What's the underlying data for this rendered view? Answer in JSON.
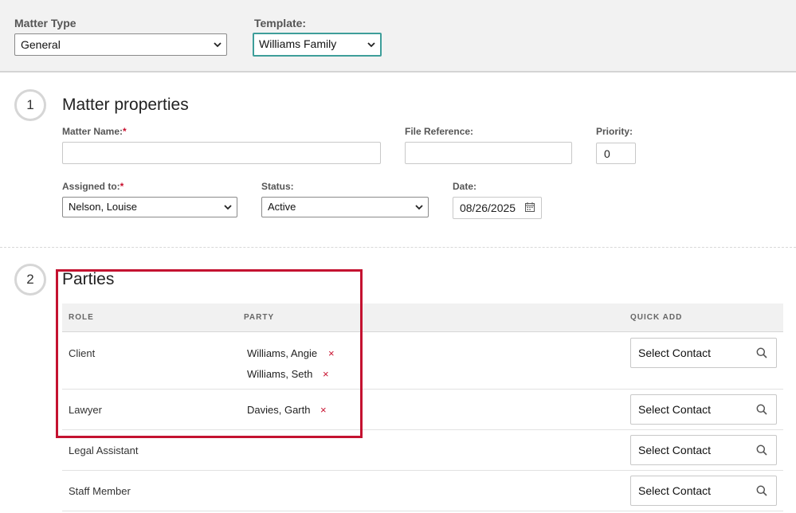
{
  "header": {
    "matter_type_label": "Matter Type",
    "matter_type_value": "General",
    "template_label": "Template:",
    "template_value": "Williams Family"
  },
  "matter_properties": {
    "step": "1",
    "title": "Matter properties",
    "matter_name_label": "Matter Name:",
    "matter_name_value": "",
    "file_reference_label": "File Reference:",
    "file_reference_value": "",
    "priority_label": "Priority:",
    "priority_value": "0",
    "assigned_to_label": "Assigned to:",
    "assigned_to_value": "Nelson, Louise",
    "status_label": "Status:",
    "status_value": "Active",
    "date_label": "Date:",
    "date_value": "08/26/2025",
    "required_marker": "*"
  },
  "parties": {
    "step": "2",
    "title": "Parties",
    "columns": {
      "role": "ROLE",
      "party": "PARTY",
      "quick_add": "QUICK ADD"
    },
    "rows": [
      {
        "role": "Client",
        "parties": [
          "Williams, Angie",
          "Williams, Seth"
        ],
        "quick_add": "Select Contact"
      },
      {
        "role": "Lawyer",
        "parties": [
          "Davies, Garth"
        ],
        "quick_add": "Select Contact"
      },
      {
        "role": "Legal Assistant",
        "parties": [],
        "quick_add": "Select Contact"
      },
      {
        "role": "Staff Member",
        "parties": [],
        "quick_add": "Select Contact"
      }
    ],
    "remove_glyph": "×"
  },
  "colors": {
    "accent_focus": "#3e9e9a",
    "required": "#c8102e",
    "highlight": "#c41230"
  },
  "icons": [
    "chevron-down-icon",
    "calendar-icon",
    "search-icon",
    "close-icon"
  ]
}
